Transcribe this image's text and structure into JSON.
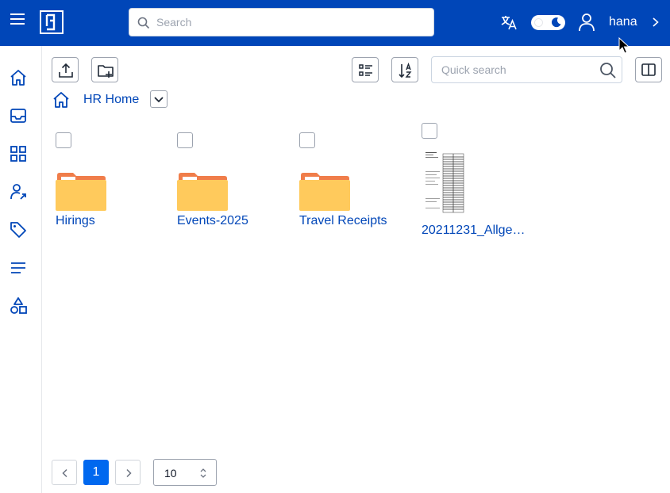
{
  "topbar": {
    "search_placeholder": "Search",
    "username": "hana",
    "brand_color": "#0046b8"
  },
  "sidebar": {
    "items": [
      "home-icon",
      "inbox-icon",
      "apps-icon",
      "user-share-icon",
      "tag-icon",
      "list-icon",
      "shapes-icon"
    ]
  },
  "toolbar": {
    "quick_search_placeholder": "Quick search"
  },
  "breadcrumb": {
    "label": "HR Home"
  },
  "items": [
    {
      "type": "folder",
      "label": "Hirings"
    },
    {
      "type": "folder",
      "label": "Events-2025"
    },
    {
      "type": "folder",
      "label": "Travel Receipts"
    },
    {
      "type": "document",
      "label": "20211231_Allge…"
    }
  ],
  "pagination": {
    "current_page": "1",
    "per_page": "10"
  }
}
